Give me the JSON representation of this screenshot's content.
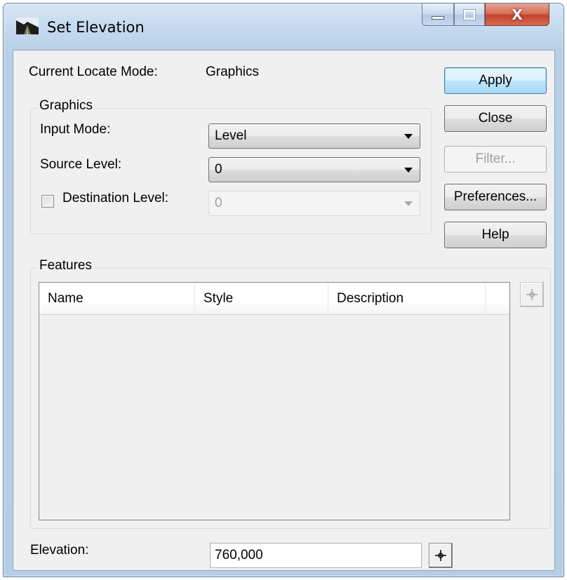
{
  "window": {
    "title": "Set Elevation",
    "close_glyph": "X"
  },
  "locate": {
    "label": "Current Locate Mode:",
    "value": "Graphics"
  },
  "graphics_group": {
    "title": "Graphics",
    "input_mode_label": "Input Mode:",
    "input_mode_value": "Level",
    "source_level_label": "Source Level:",
    "source_level_value": "0",
    "destination_level_label": "Destination Level:",
    "destination_level_value": "0",
    "destination_checked": false
  },
  "buttons": {
    "apply": "Apply",
    "close": "Close",
    "filter": "Filter...",
    "preferences": "Preferences...",
    "help": "Help"
  },
  "features_group": {
    "title": "Features",
    "columns": [
      "Name",
      "Style",
      "Description"
    ],
    "rows": []
  },
  "elevation": {
    "label": "Elevation:",
    "value": "760,000"
  },
  "icons": {
    "app": "road-elevation-icon",
    "locate": "crosshair-icon"
  }
}
